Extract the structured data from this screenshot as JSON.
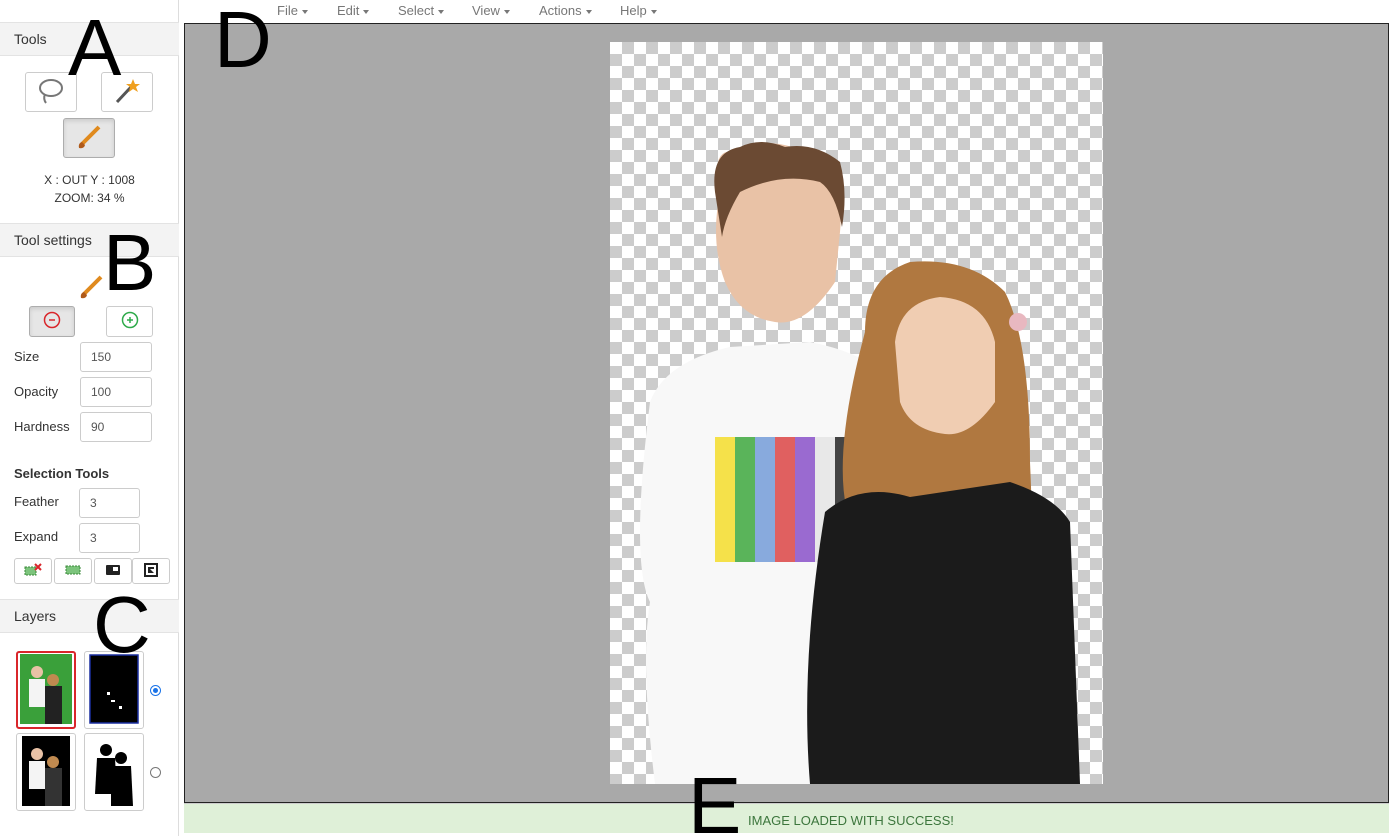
{
  "menu": [
    {
      "label": "File"
    },
    {
      "label": "Edit"
    },
    {
      "label": "Select"
    },
    {
      "label": "View"
    },
    {
      "label": "Actions"
    },
    {
      "label": "Help"
    }
  ],
  "tools": {
    "title": "Tools",
    "buttons": [
      {
        "icon": "lasso-icon"
      },
      {
        "icon": "magic-wand-icon"
      },
      {
        "icon": "brush-icon",
        "active": true
      }
    ],
    "coords": "X : OUT Y : 1008",
    "zoom": "ZOOM: 34 %"
  },
  "tool_settings": {
    "title": "Tool settings",
    "size_label": "Size",
    "size_value": "150",
    "opacity_label": "Opacity",
    "opacity_value": "100",
    "hardness_label": "Hardness",
    "hardness_value": "90",
    "selection_tools_label": "Selection Tools",
    "feather_label": "Feather",
    "feather_value": "3",
    "expand_label": "Expand",
    "expand_value": "3"
  },
  "layers": {
    "title": "Layers"
  },
  "status": {
    "message": "IMAGE LOADED WITH SUCCESS!"
  },
  "annotations": {
    "a": "A",
    "b": "B",
    "c": "C",
    "d": "D",
    "e": "E"
  },
  "colors": {
    "status_bg": "#dff0d8",
    "status_text": "#3c763d",
    "workspace_bg": "#a9a9a9",
    "selected_layer_border": "#d9262b"
  }
}
